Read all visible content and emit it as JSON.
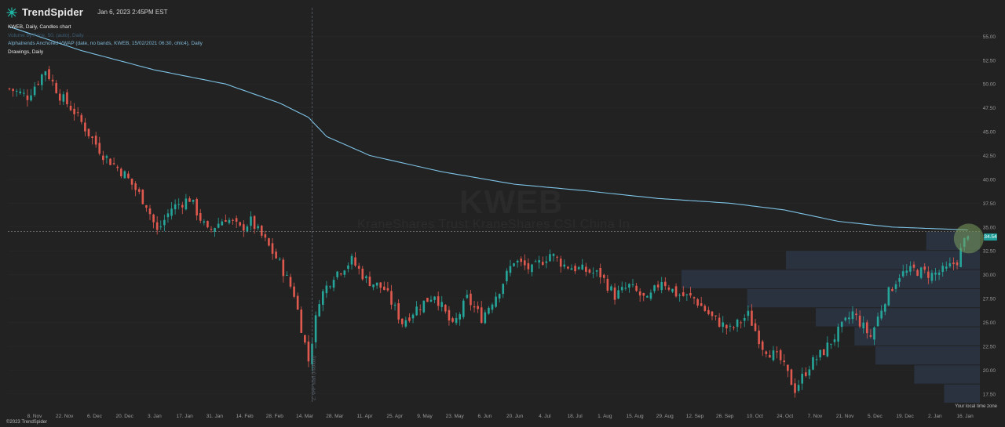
{
  "app": {
    "brand": "TrendSpider",
    "timestamp": "Jan 6, 2023 2:45PM EST",
    "copyright": "©2023 TrendSpider",
    "timezone_label": "Your local time zone",
    "watermark": "KWEB",
    "watermark_sub": "KraneShares Trust KraneShares CSI China In"
  },
  "legend": {
    "series": "KWEB, Daily, Candles chart",
    "volume": "Volume by Price, 50, (auto), Daily",
    "vwap": "Alphatrends Anchored VWAP (date, no bands, KWEB, 15/02/2021 06:30, ohlc4), Daily",
    "drawings": "Drawings, Daily"
  },
  "colors": {
    "background": "#222222",
    "up": "#26a69a",
    "down": "#e0594f",
    "vwap": "#7ec3e6",
    "volume_profile": "#2c3545",
    "grid": "#2b2b2b",
    "highlight": "#7a9f5e",
    "price_tag": "#1f9e9a"
  },
  "annotations": {
    "vertical_marker_label": "2. VAP start (manual)"
  },
  "chart_data": {
    "type": "candlestick",
    "title": "KWEB, Daily, Candles chart",
    "ylim": [
      16.5,
      57.0
    ],
    "last_price": "34.54",
    "y_ticks": [
      17.5,
      20.0,
      22.5,
      25.0,
      27.5,
      30.0,
      32.5,
      35.0,
      37.5,
      40.0,
      42.5,
      45.0,
      47.5,
      50.0,
      52.5,
      55.0
    ],
    "x_ticks": [
      "8. Nov",
      "22. Nov",
      "6. Dec",
      "20. Dec",
      "3. Jan",
      "17. Jan",
      "31. Jan",
      "14. Feb",
      "28. Feb",
      "14. Mar",
      "28. Mar",
      "11. Apr",
      "25. Apr",
      "9. May",
      "23. May",
      "6. Jun",
      "20. Jun",
      "4. Jul",
      "18. Jul",
      "1. Aug",
      "15. Aug",
      "29. Aug",
      "12. Sep",
      "26. Sep",
      "10. Oct",
      "24. Oct",
      "7. Nov",
      "21. Nov",
      "5. Dec",
      "19. Dec",
      "2. Jan",
      "16. Jan"
    ],
    "x_anchors": [
      {
        "d": 0,
        "c": 49.5
      },
      {
        "d": 5,
        "c": 48.7
      },
      {
        "d": 10,
        "c": 51.5
      },
      {
        "d": 14,
        "c": 48.8
      },
      {
        "d": 18,
        "c": 47.1
      },
      {
        "d": 22,
        "c": 44.8
      },
      {
        "d": 26,
        "c": 42.6
      },
      {
        "d": 32,
        "c": 40.5
      },
      {
        "d": 38,
        "c": 37.4
      },
      {
        "d": 41,
        "c": 34.5
      },
      {
        "d": 45,
        "c": 37.0
      },
      {
        "d": 50,
        "c": 38.0
      },
      {
        "d": 55,
        "c": 34.5
      },
      {
        "d": 60,
        "c": 36.0
      },
      {
        "d": 64,
        "c": 34.8
      },
      {
        "d": 67,
        "c": 35.6
      },
      {
        "d": 71,
        "c": 33.5
      },
      {
        "d": 75,
        "c": 31.2
      },
      {
        "d": 79,
        "c": 28.0
      },
      {
        "d": 83,
        "c": 21.0
      },
      {
        "d": 86,
        "c": 27.5
      },
      {
        "d": 90,
        "c": 30.0
      },
      {
        "d": 95,
        "c": 31.5
      },
      {
        "d": 99,
        "c": 29.5
      },
      {
        "d": 104,
        "c": 28.5
      },
      {
        "d": 109,
        "c": 25.0
      },
      {
        "d": 113,
        "c": 26.5
      },
      {
        "d": 118,
        "c": 28.0
      },
      {
        "d": 123,
        "c": 24.5
      },
      {
        "d": 127,
        "c": 27.5
      },
      {
        "d": 131,
        "c": 25.5
      },
      {
        "d": 136,
        "c": 28.5
      },
      {
        "d": 140,
        "c": 31.5
      },
      {
        "d": 145,
        "c": 30.5
      },
      {
        "d": 150,
        "c": 32.2
      },
      {
        "d": 154,
        "c": 31.0
      },
      {
        "d": 159,
        "c": 30.5
      },
      {
        "d": 164,
        "c": 30.0
      },
      {
        "d": 168,
        "c": 27.8
      },
      {
        "d": 172,
        "c": 28.8
      },
      {
        "d": 177,
        "c": 27.2
      },
      {
        "d": 181,
        "c": 29.5
      },
      {
        "d": 185,
        "c": 28.0
      },
      {
        "d": 190,
        "c": 27.5
      },
      {
        "d": 195,
        "c": 25.5
      },
      {
        "d": 200,
        "c": 24.2
      },
      {
        "d": 205,
        "c": 25.8
      },
      {
        "d": 209,
        "c": 22.5
      },
      {
        "d": 214,
        "c": 21.0
      },
      {
        "d": 218,
        "c": 18.0
      },
      {
        "d": 222,
        "c": 20.5
      },
      {
        "d": 226,
        "c": 22.0
      },
      {
        "d": 230,
        "c": 24.0
      },
      {
        "d": 234,
        "c": 26.0
      },
      {
        "d": 239,
        "c": 23.5
      },
      {
        "d": 243,
        "c": 27.5
      },
      {
        "d": 247,
        "c": 30.0
      },
      {
        "d": 251,
        "c": 30.5
      },
      {
        "d": 256,
        "c": 30.0
      },
      {
        "d": 260,
        "c": 30.5
      },
      {
        "d": 263,
        "c": 31.5
      },
      {
        "d": 266,
        "c": 34.5
      }
    ],
    "vwap_anchors": [
      {
        "d": 0,
        "v": 56.0
      },
      {
        "d": 20,
        "v": 53.5
      },
      {
        "d": 40,
        "v": 51.5
      },
      {
        "d": 60,
        "v": 50.0
      },
      {
        "d": 75,
        "v": 48.0
      },
      {
        "d": 83,
        "v": 46.5
      },
      {
        "d": 88,
        "v": 44.5
      },
      {
        "d": 100,
        "v": 42.5
      },
      {
        "d": 120,
        "v": 40.8
      },
      {
        "d": 140,
        "v": 39.5
      },
      {
        "d": 160,
        "v": 38.8
      },
      {
        "d": 180,
        "v": 38.0
      },
      {
        "d": 200,
        "v": 37.5
      },
      {
        "d": 215,
        "v": 36.8
      },
      {
        "d": 230,
        "v": 35.6
      },
      {
        "d": 245,
        "v": 35.0
      },
      {
        "d": 266,
        "v": 34.7
      }
    ],
    "volume_profile": [
      {
        "lo": 16.5,
        "hi": 18.5,
        "w": 0.12
      },
      {
        "lo": 18.5,
        "hi": 20.5,
        "w": 0.22
      },
      {
        "lo": 20.5,
        "hi": 22.5,
        "w": 0.35
      },
      {
        "lo": 22.5,
        "hi": 24.5,
        "w": 0.42
      },
      {
        "lo": 24.5,
        "hi": 26.5,
        "w": 0.55
      },
      {
        "lo": 26.5,
        "hi": 28.5,
        "w": 0.78
      },
      {
        "lo": 28.5,
        "hi": 30.5,
        "w": 1.0
      },
      {
        "lo": 30.5,
        "hi": 32.5,
        "w": 0.65
      },
      {
        "lo": 32.5,
        "hi": 34.5,
        "w": 0.18
      }
    ]
  }
}
